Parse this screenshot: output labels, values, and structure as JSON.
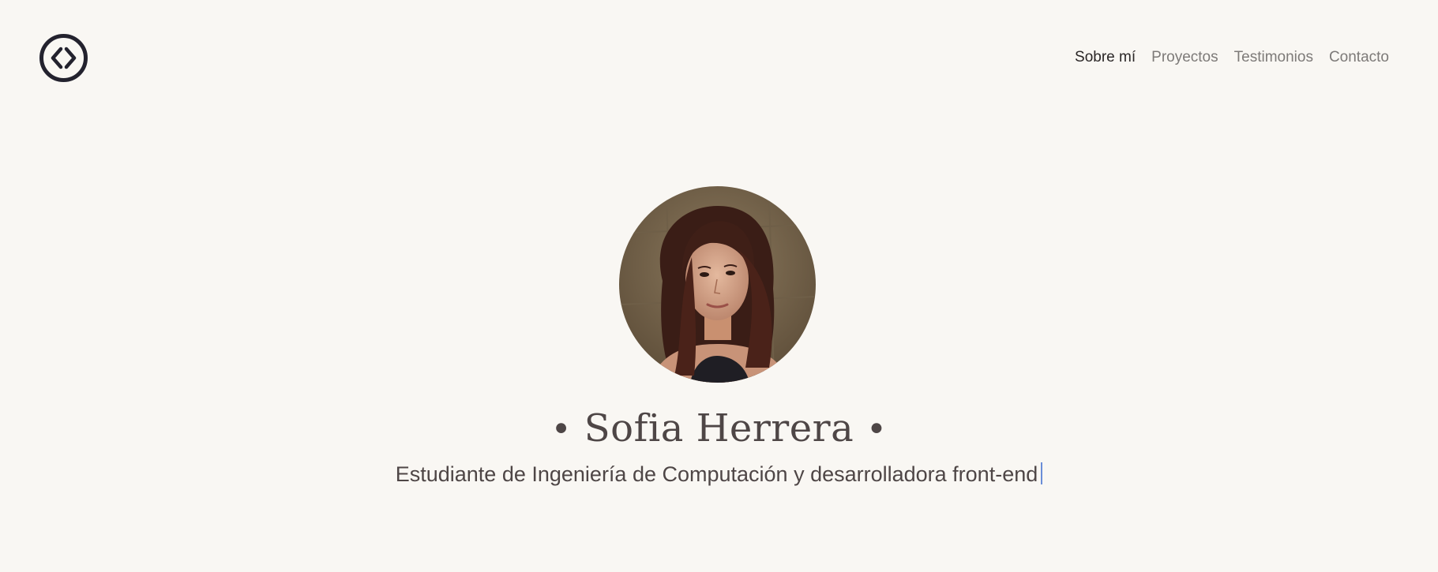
{
  "header": {
    "logo_icon": "code-brackets-logo-icon",
    "nav": [
      {
        "label": "Sobre mí",
        "active": true
      },
      {
        "label": "Proyectos",
        "active": false
      },
      {
        "label": "Testimonios",
        "active": false
      },
      {
        "label": "Contacto",
        "active": false
      }
    ]
  },
  "hero": {
    "bullet_left": "•",
    "name": "Sofia Herrera",
    "bullet_right": "•",
    "tagline": "Estudiante de Ingeniería de Computación y desarrolladora front-end"
  },
  "colors": {
    "background": "#f9f7f3",
    "text_dark": "#4e4646",
    "nav_inactive": "#7d7a78",
    "logo": "#23222e",
    "caret": "#6a8ed8"
  }
}
